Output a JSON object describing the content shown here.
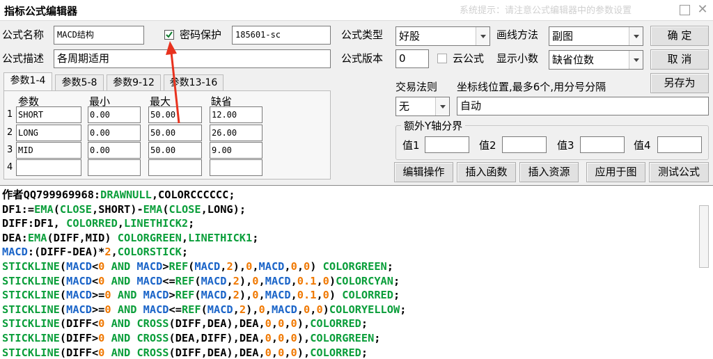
{
  "window": {
    "title": "指标公式编辑器",
    "faint_title": "系统提示：请注意公式编辑器中的参数设置",
    "restore_icon": "restore-icon",
    "close_icon": "close-icon"
  },
  "form": {
    "name_label": "公式名称",
    "name_value": "MACD结构",
    "password_check_label": "密码保护",
    "password_checked": true,
    "password_value": "185601-sc",
    "desc_label": "公式描述",
    "desc_value": "各周期适用",
    "type_label": "公式类型",
    "type_value": "好股",
    "draw_label": "画线方法",
    "draw_value": "副图",
    "version_label": "公式版本",
    "version_value": "0",
    "cloud_label": "云公式",
    "cloud_checked": false,
    "decimal_label": "显示小数",
    "decimal_value": "缺省位数",
    "trade_label": "交易法则",
    "trade_value": "无",
    "coord_label": "坐标线位置,最多6个,用分号分隔",
    "coord_value": "自动",
    "extra_y_label": "额外Y轴分界",
    "y_values": [
      "值1",
      "值2",
      "值3",
      "值4"
    ]
  },
  "buttons": {
    "ok": "确  定",
    "cancel": "取  消",
    "save_as": "另存为",
    "edit_ops": "编辑操作",
    "insert_func": "插入函数",
    "insert_res": "插入资源",
    "apply_chart": "应用于图",
    "test": "测试公式"
  },
  "tabs": [
    "参数1-4",
    "参数5-8",
    "参数9-12",
    "参数13-16"
  ],
  "params": {
    "headers": [
      "参数",
      "最小",
      "最大",
      "缺省"
    ],
    "rows": [
      {
        "n": "1",
        "name": "SHORT",
        "min": "0.00",
        "max": "50.00",
        "def": "12.00"
      },
      {
        "n": "2",
        "name": "LONG",
        "min": "0.00",
        "max": "50.00",
        "def": "26.00"
      },
      {
        "n": "3",
        "name": "MID",
        "min": "0.00",
        "max": "50.00",
        "def": "9.00"
      },
      {
        "n": "4",
        "name": "",
        "min": "",
        "max": "",
        "def": ""
      }
    ]
  },
  "code_lines": [
    [
      [
        "作者",
        "k"
      ],
      [
        "QQ799969968:",
        "k"
      ],
      [
        "DRAWNULL",
        "f"
      ],
      [
        ",COLORCCCCCC;",
        "k"
      ]
    ],
    [
      [
        "DF1:=",
        "k"
      ],
      [
        "EMA",
        "f"
      ],
      [
        "(",
        "k"
      ],
      [
        "CLOSE",
        "f"
      ],
      [
        ",SHORT)-",
        "k"
      ],
      [
        "EMA",
        "f"
      ],
      [
        "(",
        "k"
      ],
      [
        "CLOSE",
        "f"
      ],
      [
        ",LONG);",
        "k"
      ]
    ],
    [
      [
        "DIFF:DF1, ",
        "k"
      ],
      [
        "COLORRED",
        "f"
      ],
      [
        ",",
        "k"
      ],
      [
        "LINETHICK2",
        "f"
      ],
      [
        ";",
        "k"
      ]
    ],
    [
      [
        "DEA:",
        "k"
      ],
      [
        "EMA",
        "f"
      ],
      [
        "(DIFF,MID) ",
        "k"
      ],
      [
        "COLORGREEN",
        "f"
      ],
      [
        ",",
        "k"
      ],
      [
        "LINETHICK1",
        "f"
      ],
      [
        ";",
        "k"
      ]
    ],
    [
      [
        "MACD",
        "v"
      ],
      [
        ":(DIFF-DEA)*",
        "k"
      ],
      [
        "2",
        "n"
      ],
      [
        ",",
        "k"
      ],
      [
        "COLORSTICK",
        "f"
      ],
      [
        ";",
        "k"
      ]
    ],
    [
      [
        "STICKLINE",
        "f"
      ],
      [
        "(",
        "k"
      ],
      [
        "MACD",
        "v"
      ],
      [
        "<",
        "k"
      ],
      [
        "0",
        "n"
      ],
      [
        " ",
        "k"
      ],
      [
        "AND",
        "f"
      ],
      [
        " ",
        "k"
      ],
      [
        "MACD",
        "v"
      ],
      [
        ">",
        "k"
      ],
      [
        "REF",
        "f"
      ],
      [
        "(",
        "k"
      ],
      [
        "MACD",
        "v"
      ],
      [
        ",",
        "k"
      ],
      [
        "2",
        "n"
      ],
      [
        "),",
        "k"
      ],
      [
        "0",
        "n"
      ],
      [
        ",",
        "k"
      ],
      [
        "MACD",
        "v"
      ],
      [
        ",",
        "k"
      ],
      [
        "0",
        "n"
      ],
      [
        ",",
        "k"
      ],
      [
        "0",
        "n"
      ],
      [
        ") ",
        "k"
      ],
      [
        "COLORGREEN",
        "f"
      ],
      [
        ";",
        "k"
      ]
    ],
    [
      [
        "STICKLINE",
        "f"
      ],
      [
        "(",
        "k"
      ],
      [
        "MACD",
        "v"
      ],
      [
        "<",
        "k"
      ],
      [
        "0",
        "n"
      ],
      [
        " ",
        "k"
      ],
      [
        "AND",
        "f"
      ],
      [
        " ",
        "k"
      ],
      [
        "MACD",
        "v"
      ],
      [
        "<=",
        "k"
      ],
      [
        "REF",
        "f"
      ],
      [
        "(",
        "k"
      ],
      [
        "MACD",
        "v"
      ],
      [
        ",",
        "k"
      ],
      [
        "2",
        "n"
      ],
      [
        "),",
        "k"
      ],
      [
        "0",
        "n"
      ],
      [
        ",",
        "k"
      ],
      [
        "MACD",
        "v"
      ],
      [
        ",",
        "k"
      ],
      [
        "0.1",
        "n"
      ],
      [
        ",",
        "k"
      ],
      [
        "0",
        "n"
      ],
      [
        ")",
        "k"
      ],
      [
        "COLORCYAN",
        "f"
      ],
      [
        ";",
        "k"
      ]
    ],
    [
      [
        "STICKLINE",
        "f"
      ],
      [
        "(",
        "k"
      ],
      [
        "MACD",
        "v"
      ],
      [
        ">=",
        "k"
      ],
      [
        "0",
        "n"
      ],
      [
        " ",
        "k"
      ],
      [
        "AND",
        "f"
      ],
      [
        " ",
        "k"
      ],
      [
        "MACD",
        "v"
      ],
      [
        ">",
        "k"
      ],
      [
        "REF",
        "f"
      ],
      [
        "(",
        "k"
      ],
      [
        "MACD",
        "v"
      ],
      [
        ",",
        "k"
      ],
      [
        "2",
        "n"
      ],
      [
        "),",
        "k"
      ],
      [
        "0",
        "n"
      ],
      [
        ",",
        "k"
      ],
      [
        "MACD",
        "v"
      ],
      [
        ",",
        "k"
      ],
      [
        "0.1",
        "n"
      ],
      [
        ",",
        "k"
      ],
      [
        "0",
        "n"
      ],
      [
        ") ",
        "k"
      ],
      [
        "COLORRED",
        "f"
      ],
      [
        ";",
        "k"
      ]
    ],
    [
      [
        "STICKLINE",
        "f"
      ],
      [
        "(",
        "k"
      ],
      [
        "MACD",
        "v"
      ],
      [
        ">=",
        "k"
      ],
      [
        "0",
        "n"
      ],
      [
        " ",
        "k"
      ],
      [
        "AND",
        "f"
      ],
      [
        " ",
        "k"
      ],
      [
        "MACD",
        "v"
      ],
      [
        "<=",
        "k"
      ],
      [
        "REF",
        "f"
      ],
      [
        "(",
        "k"
      ],
      [
        "MACD",
        "v"
      ],
      [
        ",",
        "k"
      ],
      [
        "2",
        "n"
      ],
      [
        "),",
        "k"
      ],
      [
        "0",
        "n"
      ],
      [
        ",",
        "k"
      ],
      [
        "MACD",
        "v"
      ],
      [
        ",",
        "k"
      ],
      [
        "0",
        "n"
      ],
      [
        ",",
        "k"
      ],
      [
        "0",
        "n"
      ],
      [
        ")",
        "k"
      ],
      [
        "COLORYELLOW",
        "f"
      ],
      [
        ";",
        "k"
      ]
    ],
    [
      [
        "STICKLINE",
        "f"
      ],
      [
        "(DIFF<",
        "k"
      ],
      [
        "0",
        "n"
      ],
      [
        " ",
        "k"
      ],
      [
        "AND",
        "f"
      ],
      [
        " ",
        "k"
      ],
      [
        "CROSS",
        "f"
      ],
      [
        "(DIFF,DEA),DEA,",
        "k"
      ],
      [
        "0",
        "n"
      ],
      [
        ",",
        "k"
      ],
      [
        "0",
        "n"
      ],
      [
        ",",
        "k"
      ],
      [
        "0",
        "n"
      ],
      [
        "),",
        "k"
      ],
      [
        "COLORRED",
        "f"
      ],
      [
        ";",
        "k"
      ]
    ],
    [
      [
        "STICKLINE",
        "f"
      ],
      [
        "(DIFF>",
        "k"
      ],
      [
        "0",
        "n"
      ],
      [
        " ",
        "k"
      ],
      [
        "AND",
        "f"
      ],
      [
        " ",
        "k"
      ],
      [
        "CROSS",
        "f"
      ],
      [
        "(DEA,DIFF),DEA,",
        "k"
      ],
      [
        "0",
        "n"
      ],
      [
        ",",
        "k"
      ],
      [
        "0",
        "n"
      ],
      [
        ",",
        "k"
      ],
      [
        "0",
        "n"
      ],
      [
        "),",
        "k"
      ],
      [
        "COLORGREEN",
        "f"
      ],
      [
        ";",
        "k"
      ]
    ],
    [
      [
        "STICKLINE",
        "f"
      ],
      [
        "(DIFF<",
        "k"
      ],
      [
        "0",
        "n"
      ],
      [
        " ",
        "k"
      ],
      [
        "AND",
        "f"
      ],
      [
        " ",
        "k"
      ],
      [
        "CROSS",
        "f"
      ],
      [
        "(DIFF,DEA),DEA,",
        "k"
      ],
      [
        "0",
        "n"
      ],
      [
        ",",
        "k"
      ],
      [
        "0",
        "n"
      ],
      [
        ",",
        "k"
      ],
      [
        "0",
        "n"
      ],
      [
        "),",
        "k"
      ],
      [
        "COLORRED",
        "f"
      ],
      [
        ";",
        "k"
      ]
    ]
  ],
  "colors": {
    "keyword": "#0a9e3a",
    "variable": "#1a64c8",
    "number": "#f07800",
    "annotation_arrow": "#e8321e"
  }
}
